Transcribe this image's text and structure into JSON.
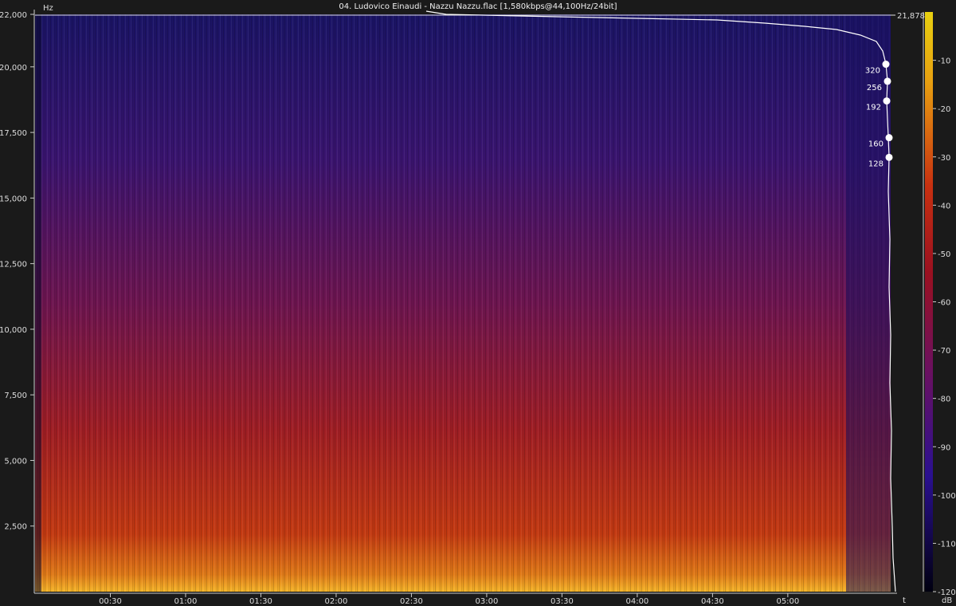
{
  "window": {
    "title": "04. Ludovico Einaudi - Nazzu Nazzu.flac [1,580kbps@44,100Hz/24bit]"
  },
  "chart_data": {
    "type": "heatmap",
    "title": "04. Ludovico Einaudi - Nazzu Nazzu.flac [1,580kbps@44,100Hz/24bit]",
    "ylabel": "Hz",
    "xlabel": "t",
    "colorbar_label": "dB",
    "ylim": [
      0,
      22000
    ],
    "xlim_seconds": [
      0,
      341
    ],
    "y_ticks": [
      2500,
      5000,
      7500,
      10000,
      12500,
      15000,
      17500,
      20000,
      22000
    ],
    "y_tick_labels": [
      "2,500",
      "5,000",
      "7,500",
      "10,000",
      "12,500",
      "15,000",
      "17,500",
      "20,000",
      "22,000"
    ],
    "x_ticks_seconds": [
      30,
      60,
      90,
      120,
      150,
      180,
      210,
      240,
      270,
      300
    ],
    "x_tick_labels": [
      "00:30",
      "01:00",
      "01:30",
      "02:00",
      "02:30",
      "03:00",
      "03:30",
      "04:00",
      "04:30",
      "05:00"
    ],
    "colorbar_ticks": [
      -10,
      -20,
      -30,
      -40,
      -50,
      -60,
      -70,
      -80,
      -90,
      -100,
      -110,
      -120
    ],
    "colorbar_tick_labels": [
      "-10",
      "-20",
      "-30",
      "-40",
      "-50",
      "-60",
      "-70",
      "-80",
      "-90",
      "-100",
      "-110",
      "-120"
    ],
    "colorbar_range_db": [
      -120,
      0
    ],
    "cutoff_label": "21,878",
    "cutoff_hz": 21878,
    "bitrate_markers": [
      {
        "label": "320",
        "hz": 20100
      },
      {
        "label": "256",
        "hz": 19450
      },
      {
        "label": "192",
        "hz": 18700
      },
      {
        "label": "160",
        "hz": 17300
      },
      {
        "label": "128",
        "hz": 16550
      }
    ],
    "colors": {
      "background": "#1a1a1a",
      "quiet": "#1a1466",
      "mid": "#8a1a3a",
      "loud": "#f0a020",
      "curve": "#ffffff"
    }
  }
}
